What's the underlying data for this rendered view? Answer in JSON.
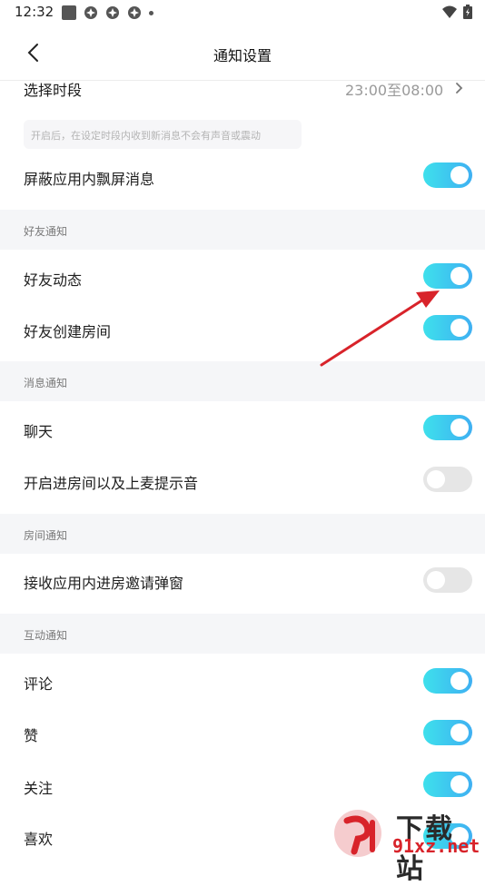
{
  "status_bar": {
    "time": "12:32",
    "icons": [
      "square-icon",
      "pinwheel-icon",
      "pinwheel-icon",
      "pinwheel-icon",
      "dot-icon",
      "wifi-icon",
      "battery-icon"
    ]
  },
  "header": {
    "title": "通知设置",
    "back_icon": "chevron-left-icon"
  },
  "settings": {
    "time_period": {
      "label": "选择时段",
      "value": "23:00至08:00"
    },
    "hint": "开启后，在设定时段内收到新消息不会有声音或震动",
    "block_popup": {
      "label": "屏蔽应用内飘屏消息",
      "on": true
    }
  },
  "sections": {
    "friend": {
      "title": "好友通知",
      "items": [
        {
          "label": "好友动态",
          "on": true
        },
        {
          "label": "好友创建房间",
          "on": true
        }
      ]
    },
    "message": {
      "title": "消息通知",
      "items": [
        {
          "label": "聊天",
          "on": true
        },
        {
          "label": "开启进房间以及上麦提示音",
          "on": false
        }
      ]
    },
    "room": {
      "title": "房间通知",
      "items": [
        {
          "label": "接收应用内进房邀请弹窗",
          "on": false
        }
      ]
    },
    "interaction": {
      "title": "互动通知",
      "items": [
        {
          "label": "评论",
          "on": true
        },
        {
          "label": "赞",
          "on": true
        },
        {
          "label": "关注",
          "on": true
        },
        {
          "label": "喜欢",
          "on": true
        }
      ]
    }
  },
  "watermark": {
    "text_top": "下载站",
    "text_bottom": "91xz.net"
  },
  "colors": {
    "toggle_on_start": "#3ee0ec",
    "toggle_on_end": "#3fb0f2",
    "toggle_off": "#e6e6e6",
    "section_bg": "#f5f6f8",
    "annotation_arrow": "#d8232a"
  }
}
